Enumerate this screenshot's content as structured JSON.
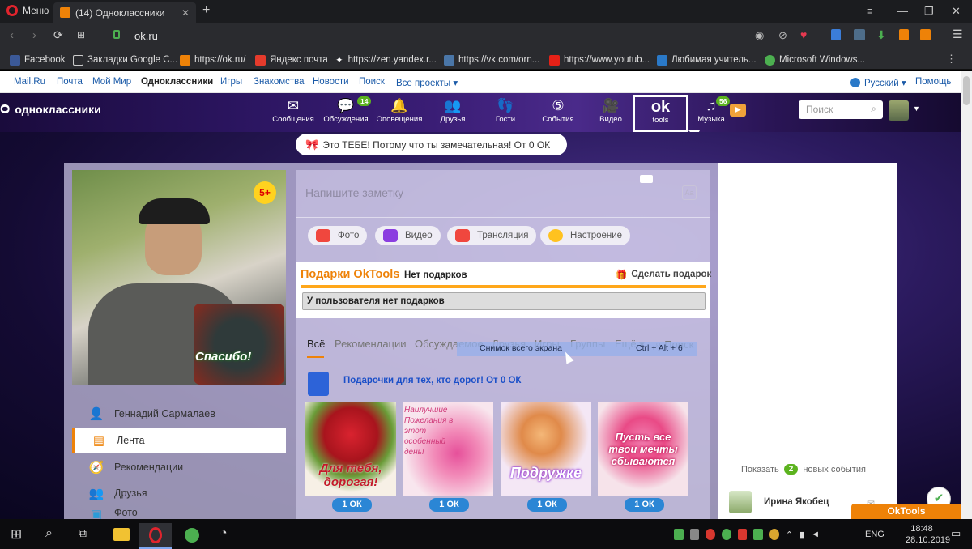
{
  "browser": {
    "menu_label": "Меню",
    "tab_title": "(14) Одноклассники",
    "new_tab": "+",
    "url": "ok.ru",
    "bookmarks": [
      "Facebook",
      "Закладки Google C...",
      "https://ok.ru/",
      "Яндекс почта",
      "https://zen.yandex.r...",
      "https://vk.com/orn...",
      "https://www.youtub...",
      "Любимая учитель...",
      "Microsoft Windows..."
    ]
  },
  "mailru_bar": {
    "links": [
      "Mail.Ru",
      "Почта",
      "Мой Мир",
      "Одноклассники",
      "Игры",
      "Знакомства",
      "Новости",
      "Поиск",
      "Все проекты ▾"
    ],
    "language": "Русский ▾",
    "help": "Помощь"
  },
  "ok_header": {
    "logo": "одноклассники",
    "nav": [
      {
        "label": "Сообщения",
        "icon": "mail-icon",
        "badge": ""
      },
      {
        "label": "Обсуждения",
        "icon": "chat-icon",
        "badge": "14"
      },
      {
        "label": "Оповещения",
        "icon": "bell-icon",
        "badge": ""
      },
      {
        "label": "Друзья",
        "icon": "friends-icon",
        "badge": ""
      },
      {
        "label": "Гости",
        "icon": "footprints-icon",
        "badge": ""
      },
      {
        "label": "События",
        "icon": "events-icon",
        "badge": ""
      },
      {
        "label": "Видео",
        "icon": "camera-icon",
        "badge": ""
      }
    ],
    "oktools_logo": "ok",
    "oktools_label": "tools",
    "music_label": "Музыка",
    "music_badge": "56",
    "search_placeholder": "Поиск"
  },
  "promo": "Это ТЕБЕ! Потому что ты замечательная! От 0 ОК",
  "profile": {
    "age_badge": "5+",
    "photo_caption": "Спасибо!",
    "menu": [
      {
        "label": "Геннадий Сармалаев",
        "icon": "person-icon"
      },
      {
        "label": "Лента",
        "icon": "feed-icon"
      },
      {
        "label": "Рекомендации",
        "icon": "compass-icon"
      },
      {
        "label": "Друзья",
        "icon": "friends-icon"
      },
      {
        "label": "Фото",
        "icon": "photo-icon"
      }
    ]
  },
  "note": {
    "placeholder": "Напишите заметку",
    "actions": [
      "Фото",
      "Видео",
      "Трансляция",
      "Настроение"
    ]
  },
  "oktools_gifts": {
    "title": "Подарки OkTools",
    "status": "Нет подарков",
    "make_gift": "Сделать подарок",
    "empty_msg": "У пользователя нет подарков"
  },
  "feed_tabs": [
    "Всё",
    "Рекомендации",
    "Обсуждаемое",
    "Друзья",
    "Игры",
    "Группы",
    "Ещё ▾"
  ],
  "feed_search": "Поиск",
  "tooltip": {
    "label": "Снимок всего экрана",
    "shortcut": "Ctrl + Alt + 6"
  },
  "gifts": {
    "header": "Подарочки для тех, кто дорог! От 0 ОК",
    "items": [
      {
        "caption": "Для тебя, дорогая!",
        "price": "1 ОК"
      },
      {
        "caption": "Наилучшие Пожелания в этот особенный день!",
        "price": "1 ОК"
      },
      {
        "caption": "Подружке",
        "price": "1 ОК"
      },
      {
        "caption": "Пусть все твои мечты сбываются",
        "price": "1 ОК"
      }
    ]
  },
  "right_panel": {
    "show_label": "Показать",
    "new_count": "2",
    "new_events": "новых события",
    "friend_name": "Ирина Якобец",
    "oktools_button": "OkTools"
  },
  "taskbar": {
    "lang": "ENG",
    "time": "18:48",
    "date": "28.10.2019"
  }
}
